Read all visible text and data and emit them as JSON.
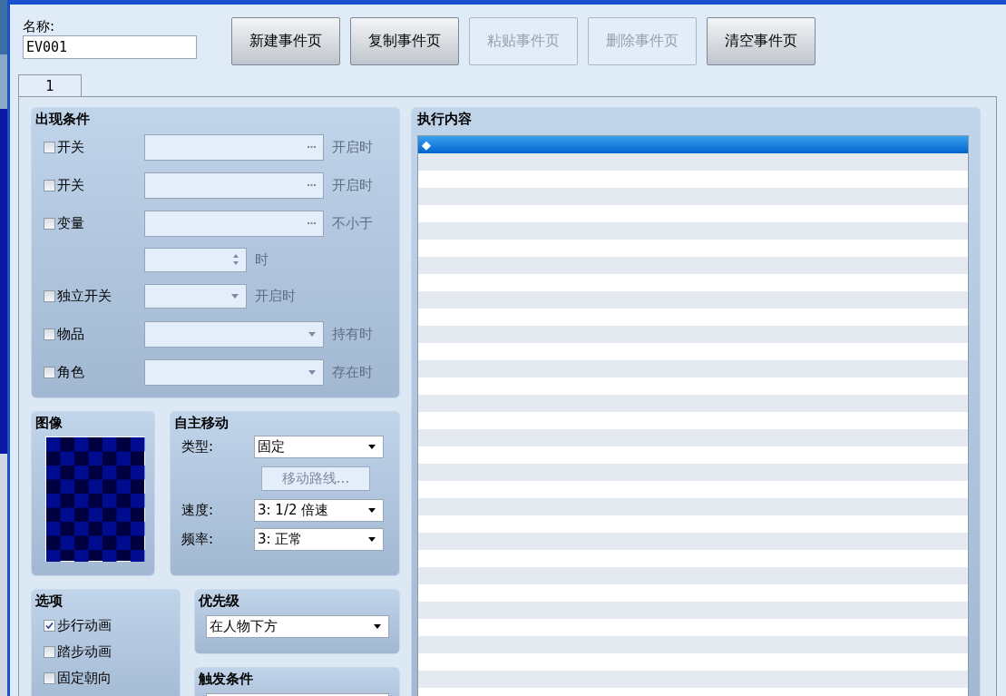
{
  "name_field": {
    "label": "名称:",
    "value": "EV001"
  },
  "buttons": [
    {
      "label": "新建事件页",
      "disabled": false
    },
    {
      "label": "复制事件页",
      "disabled": false
    },
    {
      "label": "粘贴事件页",
      "disabled": true
    },
    {
      "label": "删除事件页",
      "disabled": true
    },
    {
      "label": "清空事件页",
      "disabled": false
    }
  ],
  "tabs": [
    {
      "label": "1",
      "selected": true
    }
  ],
  "conditions": {
    "title": "出现条件",
    "rows": [
      {
        "kind": "picker",
        "label": "开关",
        "checked": false,
        "suffix": "开启时"
      },
      {
        "kind": "picker",
        "label": "开关",
        "checked": false,
        "suffix": "开启时"
      },
      {
        "kind": "picker",
        "label": "变量",
        "checked": false,
        "suffix": "不小于"
      },
      {
        "kind": "spin",
        "suffix": "时"
      },
      {
        "kind": "short-dropdown",
        "label": "独立开关",
        "checked": false,
        "suffix": "开启时"
      },
      {
        "kind": "dropdown",
        "label": "物品",
        "checked": false,
        "suffix": "持有时"
      },
      {
        "kind": "dropdown",
        "label": "角色",
        "checked": false,
        "suffix": "存在时"
      }
    ]
  },
  "image": {
    "title": "图像"
  },
  "movement": {
    "title": "自主移动",
    "type": {
      "label": "类型:",
      "value": "固定"
    },
    "route_button": {
      "label": "移动路线...",
      "disabled": true
    },
    "speed": {
      "label": "速度:",
      "value": "3: 1/2 倍速"
    },
    "frequency": {
      "label": "频率:",
      "value": "3: 正常"
    }
  },
  "options": {
    "title": "选项",
    "items": [
      {
        "label": "步行动画",
        "checked": true
      },
      {
        "label": "踏步动画",
        "checked": false
      },
      {
        "label": "固定朝向",
        "checked": false
      }
    ]
  },
  "priority": {
    "title": "优先级",
    "value": "在人物下方"
  },
  "trigger": {
    "title": "触发条件"
  },
  "contents": {
    "title": "执行内容",
    "items": [
      {
        "text": "◆",
        "selected": true
      }
    ]
  }
}
